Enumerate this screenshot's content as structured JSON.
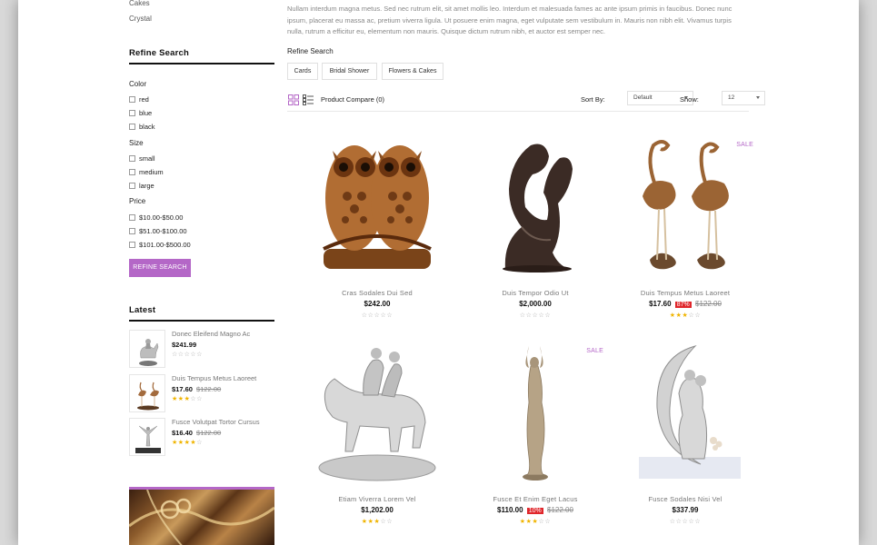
{
  "sidebar": {
    "categories": [
      "Cakes",
      "Crystal"
    ],
    "refine_title": "Refine Search",
    "color_label": "Color",
    "colors": [
      "red",
      "blue",
      "black"
    ],
    "size_label": "Size",
    "sizes": [
      "small",
      "medium",
      "large"
    ],
    "price_label": "Price",
    "prices": [
      "$10.00-$50.00",
      "$51.00-$100.00",
      "$101.00-$500.00"
    ],
    "refine_button": "REFINE SEARCH",
    "latest_title": "Latest",
    "latest": [
      {
        "name": "Donec Eleifend Magno Ac",
        "price": "$241.99",
        "old": "",
        "rating": 0,
        "icon": "horse-rider-statue"
      },
      {
        "name": "Duis Tempus Metus Laoreet",
        "price": "$17.60",
        "old": "$122.00",
        "rating": 3,
        "icon": "flamingo-statue"
      },
      {
        "name": "Fusce Volutpat Tortor Cursus",
        "price": "$16.40",
        "old": "$122.00",
        "rating": 4,
        "icon": "dancers-statue"
      }
    ]
  },
  "main": {
    "description": "Nullam interdum magna metus. Sed nec rutrum elit, sit amet mollis leo. Interdum et malesuada fames ac ante ipsum primis in faucibus. Donec nunc ipsum, placerat eu massa ac, pretium viverra ligula. Ut posuere enim magna, eget vulputate sem vestibulum in. Mauris non nibh elit. Vivamus turpis nulla, rutrum a efficitur eu, elementum non mauris. Quisque dictum rutrum nibh, et auctor est semper nec.",
    "refine_heading": "Refine Search",
    "chips": [
      "Cards",
      "Bridal Shower",
      "Flowers & Cakes"
    ],
    "compare": "Product Compare (0)",
    "sort_label": "Sort By:",
    "sort_value": "Default",
    "show_label": "Show:",
    "show_value": "12",
    "products": [
      {
        "name": "Cras Sodales Dui Sed",
        "price": "$242.00",
        "discount": "",
        "old": "",
        "rating": 0,
        "sale": "",
        "icon": "owl-pair-statue"
      },
      {
        "name": "Duis Tempor Odio Ut",
        "price": "$2,000.00",
        "discount": "",
        "old": "",
        "rating": 0,
        "sale": "",
        "icon": "abstract-couple-statue"
      },
      {
        "name": "Duis Tempus Metus Laoreet",
        "price": "$17.60",
        "discount": "87%",
        "old": "$122.00",
        "rating": 3,
        "sale": "SALE",
        "icon": "flamingo-statue"
      },
      {
        "name": "Etiam Viverra Lorem Vel",
        "price": "$1,202.00",
        "discount": "",
        "old": "",
        "rating": 3,
        "sale": "",
        "icon": "horse-couple-statue"
      },
      {
        "name": "Fusce Et Enim Eget Lacus",
        "price": "$110.00",
        "discount": "10%",
        "old": "$122.00",
        "rating": 3,
        "sale": "SALE",
        "icon": "dancer-figurine"
      },
      {
        "name": "Fusce Sodales Nisi Vel",
        "price": "$337.99",
        "discount": "",
        "old": "",
        "rating": 0,
        "sale": "",
        "icon": "moon-couple-statue"
      }
    ]
  },
  "colors": {
    "accent": "#b467c7",
    "discount": "#e0262b",
    "star": "#f0b400"
  }
}
